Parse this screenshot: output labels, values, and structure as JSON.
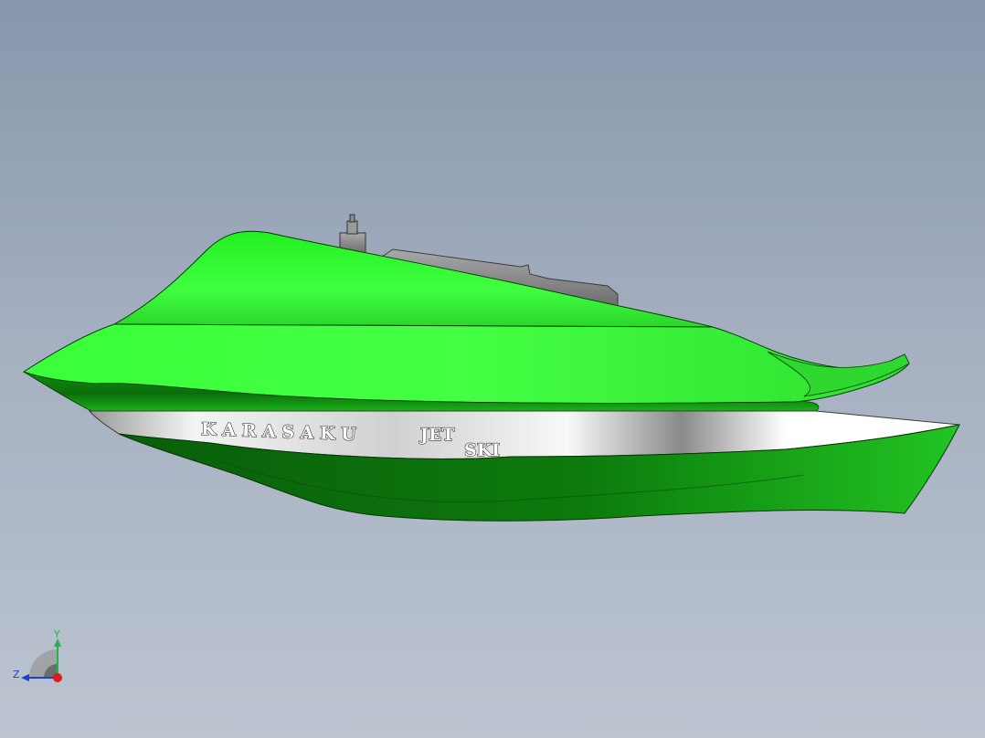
{
  "viewport": {
    "background_top": "#8797ab",
    "background_bottom": "#bcc4d0"
  },
  "model": {
    "hull_branding": {
      "brand_text": "K A R A S A K U",
      "model_line1": "JET",
      "model_line2": "SKI"
    },
    "colors": {
      "deck_green": "#33ff33",
      "hull_green_dark": "#0b7a0b",
      "chrome_band": "#e8e8e8",
      "fitting_gray": "#8c8c8c"
    }
  },
  "triad": {
    "y_label": "Y",
    "z_label": "Z",
    "colors": {
      "y_axis": "#22b14c",
      "z_axis": "#1f3fd6",
      "x_axis": "#e01b1b"
    }
  }
}
